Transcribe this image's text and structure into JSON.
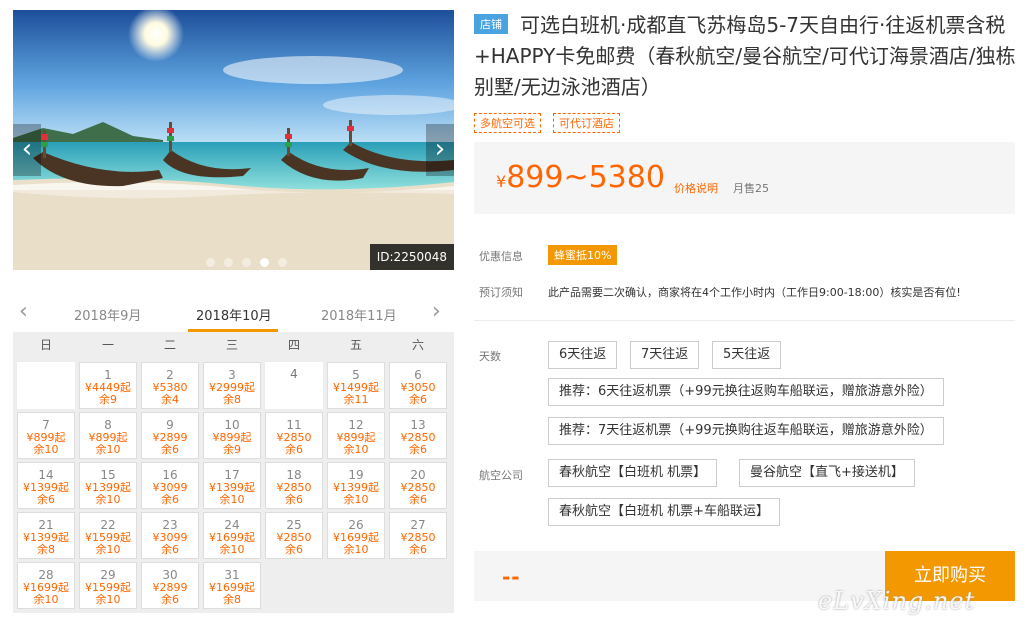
{
  "gallery": {
    "prev": "‹",
    "next": "›",
    "dots": 5,
    "active_dot": 4,
    "image_id": "ID:2250048"
  },
  "calendar": {
    "prev_month": "2018年9月",
    "current_month": "2018年10月",
    "next_month": "2018年11月",
    "arrow_left": "‹",
    "arrow_right": "›",
    "weekdays": [
      "日",
      "一",
      "二",
      "三",
      "四",
      "五",
      "六"
    ],
    "leading_empty": 1,
    "days": [
      {
        "d": "1",
        "p": "¥4449起",
        "r": "余9"
      },
      {
        "d": "2",
        "p": "¥5380",
        "r": "余4"
      },
      {
        "d": "3",
        "p": "¥2999起",
        "r": "余8"
      },
      {
        "d": "4",
        "p": "",
        "r": ""
      },
      {
        "d": "5",
        "p": "¥1499起",
        "r": "余11"
      },
      {
        "d": "6",
        "p": "¥3050",
        "r": "余6"
      },
      {
        "d": "7",
        "p": "¥899起",
        "r": "余10"
      },
      {
        "d": "8",
        "p": "¥899起",
        "r": "余10"
      },
      {
        "d": "9",
        "p": "¥2899",
        "r": "余6"
      },
      {
        "d": "10",
        "p": "¥899起",
        "r": "余9"
      },
      {
        "d": "11",
        "p": "¥2850",
        "r": "余6"
      },
      {
        "d": "12",
        "p": "¥899起",
        "r": "余10"
      },
      {
        "d": "13",
        "p": "¥2850",
        "r": "余6"
      },
      {
        "d": "14",
        "p": "¥1399起",
        "r": "余6"
      },
      {
        "d": "15",
        "p": "¥1399起",
        "r": "余10"
      },
      {
        "d": "16",
        "p": "¥3099",
        "r": "余6"
      },
      {
        "d": "17",
        "p": "¥1399起",
        "r": "余10"
      },
      {
        "d": "18",
        "p": "¥2850",
        "r": "余6"
      },
      {
        "d": "19",
        "p": "¥1399起",
        "r": "余10"
      },
      {
        "d": "20",
        "p": "¥2850",
        "r": "余6"
      },
      {
        "d": "21",
        "p": "¥1399起",
        "r": "余8"
      },
      {
        "d": "22",
        "p": "¥1599起",
        "r": "余10"
      },
      {
        "d": "23",
        "p": "¥3099",
        "r": "余6"
      },
      {
        "d": "24",
        "p": "¥1699起",
        "r": "余10"
      },
      {
        "d": "25",
        "p": "¥2850",
        "r": "余6"
      },
      {
        "d": "26",
        "p": "¥1699起",
        "r": "余10"
      },
      {
        "d": "27",
        "p": "¥2850",
        "r": "余6"
      },
      {
        "d": "28",
        "p": "¥1699起",
        "r": "余10"
      },
      {
        "d": "29",
        "p": "¥1599起",
        "r": "余10"
      },
      {
        "d": "30",
        "p": "¥2899",
        "r": "余6"
      },
      {
        "d": "31",
        "p": "¥1699起",
        "r": "余8"
      }
    ]
  },
  "product": {
    "shop_badge": "店铺",
    "title": "可选白班机·成都直飞苏梅岛5-7天自由行·往返机票含税+HAPPY卡免邮费（春秋航空/曼谷航空/可代订海景酒店/独栋别墅/无边泳池酒店）",
    "tags": [
      "多航空可选",
      "可代订酒店"
    ],
    "price_yen": "¥",
    "price": "899~5380",
    "price_note": "价格说明",
    "monthly_sales": "月售25",
    "promo_label": "优惠信息",
    "promo_badge": "蜂蜜抵10%",
    "notice_label": "预订须知",
    "notice_text": "此产品需要二次确认，商家将在4个工作小时内（工作日9:00-18:00）核实是否有位!",
    "days_label": "天数",
    "day_options": [
      "6天往返",
      "7天往返",
      "5天往返"
    ],
    "recommend_options": [
      "推荐：6天往返机票（+99元换往返购车船联运，赠旅游意外险）",
      "推荐：7天往返机票（+99元换购往返车船联运，赠旅游意外险）"
    ],
    "airline_label": "航空公司",
    "airline_options": [
      "春秋航空【白班机 机票】",
      "曼谷航空【直飞+接送机】",
      "春秋航空【白班机 机票+车船联运】"
    ],
    "qty": "--",
    "buy_label": "立即购买",
    "watermark": "eLvXing.net"
  },
  "colors": {
    "accent": "#f39800",
    "price": "#ff6600",
    "shop_badge": "#4aa3df"
  }
}
